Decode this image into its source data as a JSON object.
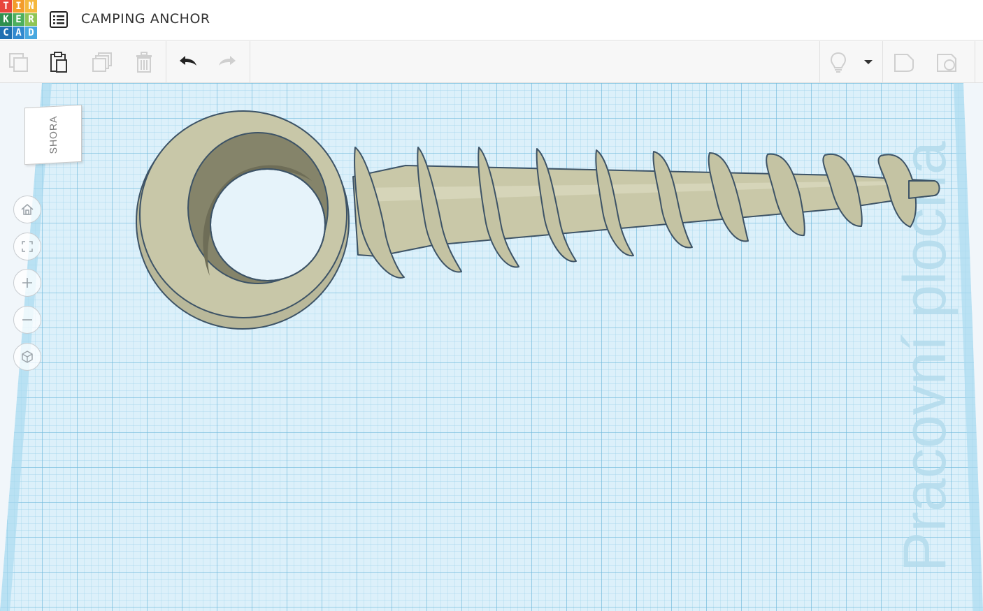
{
  "app": {
    "logo_letters": [
      "T",
      "I",
      "N",
      "K",
      "E",
      "R",
      "C",
      "A",
      "D"
    ],
    "logo_colors": [
      "#e8453c",
      "#f39c2b",
      "#f5b83d",
      "#2f8f4e",
      "#4daf5e",
      "#8fc555",
      "#1f6fb2",
      "#3189cf",
      "#48a8e0"
    ],
    "title": "CAMPING ANCHOR"
  },
  "toolbar": {
    "buttons": [
      "copy-icon",
      "paste-icon",
      "duplicate-icon",
      "delete-icon",
      "undo-icon",
      "redo-icon",
      "light-bulb-icon",
      "dropdown-arrow-icon",
      "shape-note-icon",
      "shape-comment-icon"
    ]
  },
  "viewcube": {
    "label": "SHORA"
  },
  "nav_controls": [
    "home-icon",
    "fit-view-icon",
    "zoom-in-icon",
    "zoom-out-icon",
    "perspective-icon"
  ],
  "workplane": {
    "watermark": "Pracovní plocha",
    "grid_color": "#7fc3e3",
    "plane_color": "#d9eef8"
  },
  "model": {
    "name": "camping anchor",
    "color": "#c6c5a6"
  }
}
